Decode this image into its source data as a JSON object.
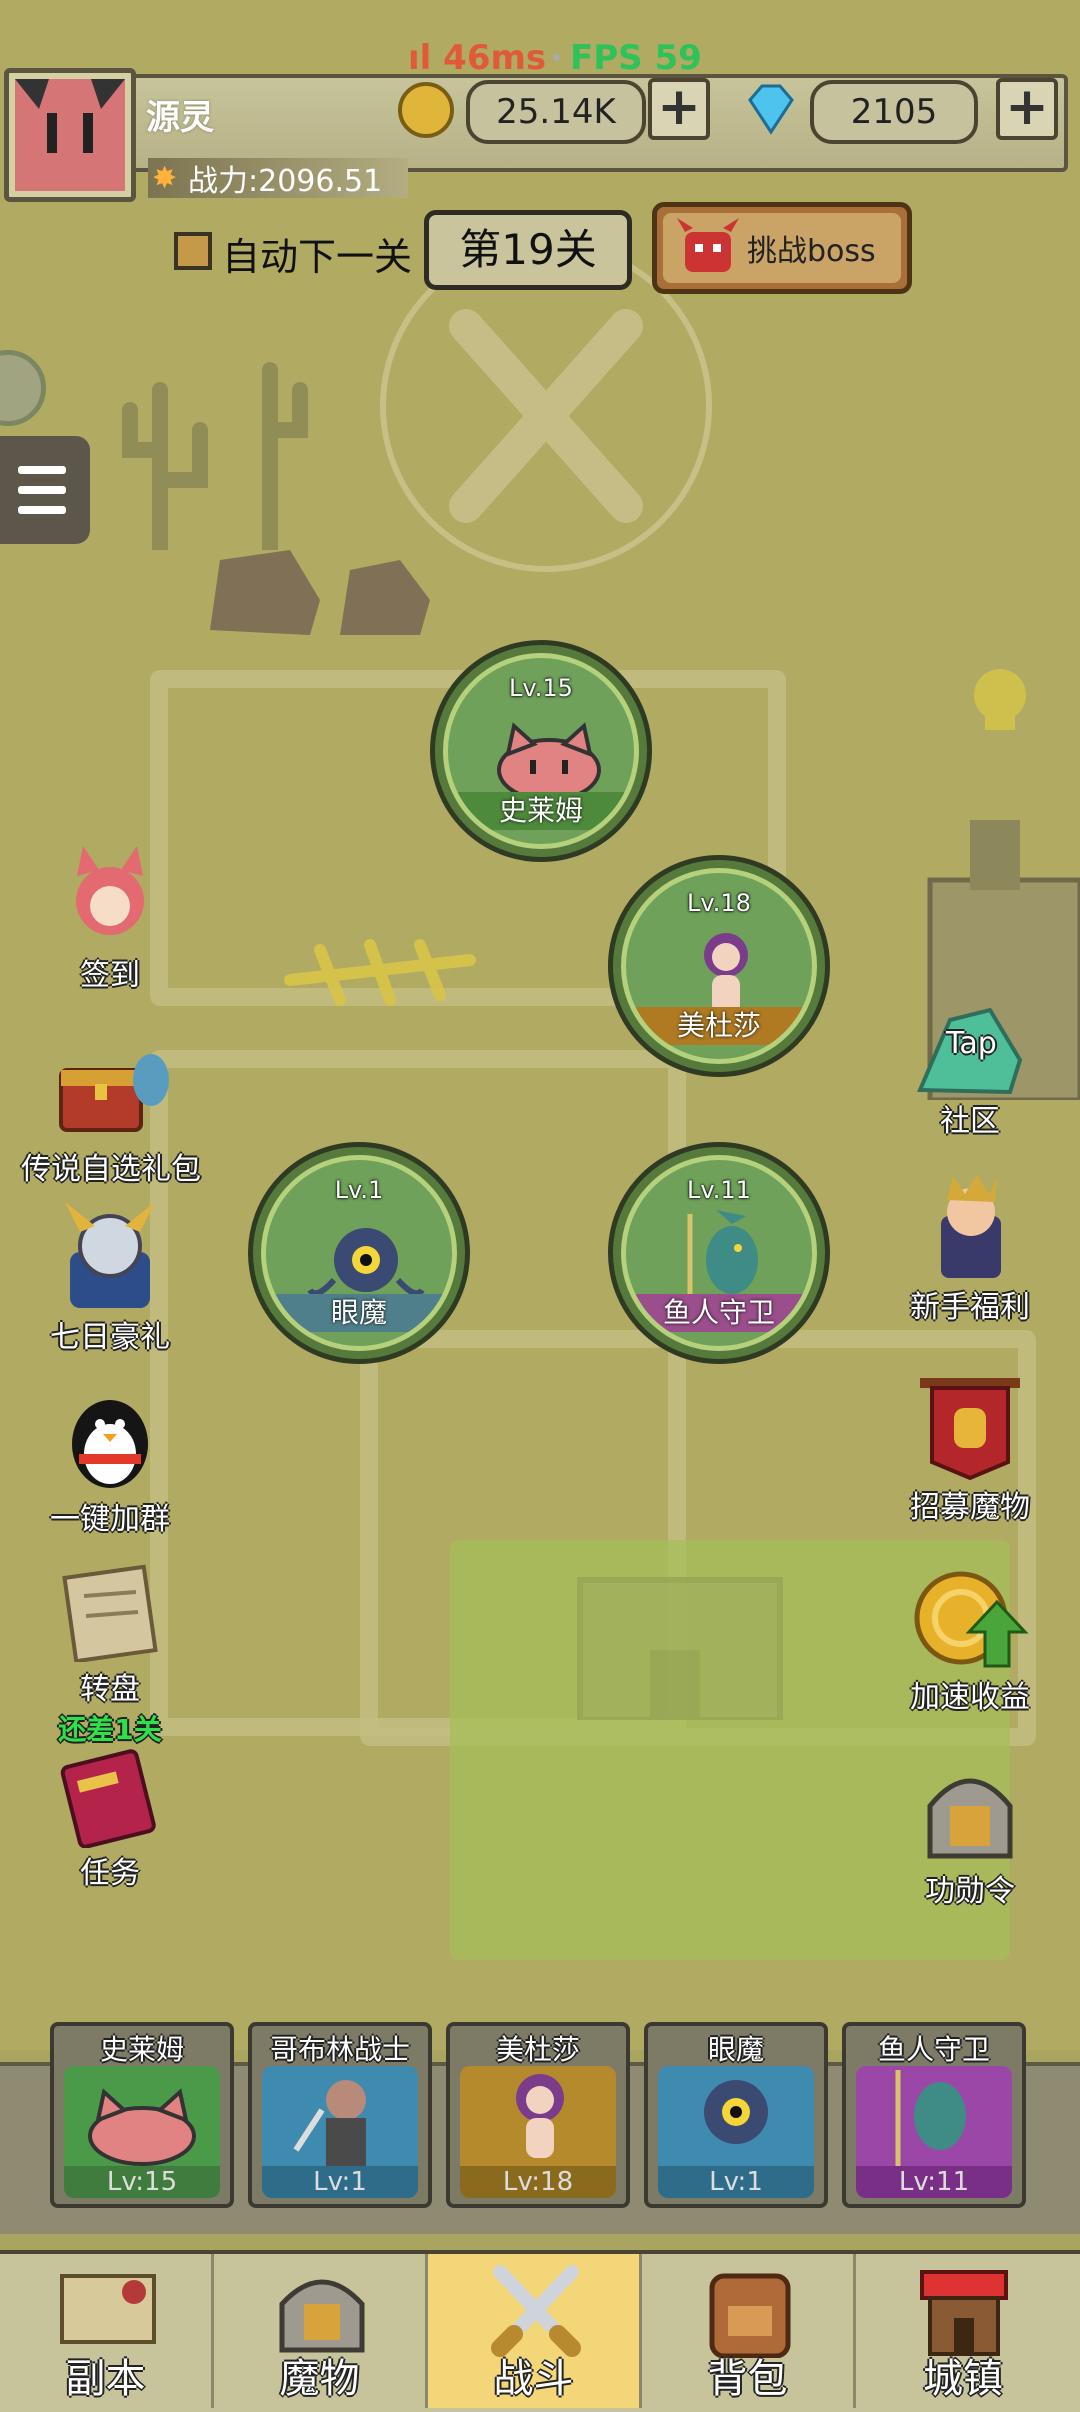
{
  "perf": {
    "ping": "46ms",
    "separator": "·",
    "fps": "FPS 59"
  },
  "player": {
    "name": "源灵",
    "power": "战力:2096.51"
  },
  "currency": {
    "gold": "25.14K",
    "gems": "2105"
  },
  "stage": {
    "auto_next_label": "自动下一关",
    "auto_next_checked": false,
    "current": "第19关",
    "boss_button": "挑战boss"
  },
  "map_nodes": [
    {
      "level": "Lv.15",
      "name": "史莱姆",
      "band_color": "#4d8a3b"
    },
    {
      "level": "Lv.18",
      "name": "美杜莎",
      "band_color": "#b07a22"
    },
    {
      "level": "Lv.1",
      "name": "眼魔",
      "band_color": "#4f7f8a"
    },
    {
      "level": "Lv.11",
      "name": "鱼人守卫",
      "band_color": "#9a4e8b"
    }
  ],
  "left_menu": [
    {
      "label": "签到",
      "icon": "catgirl-icon"
    },
    {
      "label": "传说自选礼包",
      "icon": "treasure-chest-icon"
    },
    {
      "label": "七日豪礼",
      "icon": "knight-icon"
    },
    {
      "label": "一键加群",
      "icon": "penguin-icon"
    },
    {
      "label": "转盘",
      "sub": "还差1关",
      "icon": "scroll-icon"
    },
    {
      "label": "任务",
      "icon": "book-icon"
    }
  ],
  "right_menu": [
    {
      "label": "社区",
      "icon": "tap-community-icon",
      "icon_text": "Tap"
    },
    {
      "label": "新手福利",
      "icon": "warrior-icon"
    },
    {
      "label": "招募魔物",
      "icon": "banner-helmet-icon"
    },
    {
      "label": "加速收益",
      "icon": "gold-coin-arrow-icon"
    },
    {
      "label": "功勋令",
      "icon": "helmet-icon"
    }
  ],
  "team": [
    {
      "name": "史莱姆",
      "level": "Lv:15",
      "bg": "#4b9a4a"
    },
    {
      "name": "哥布林战士",
      "level": "Lv:1",
      "bg": "#3f8bb0"
    },
    {
      "name": "美杜莎",
      "level": "Lv:18",
      "bg": "#b58a2c"
    },
    {
      "name": "眼魔",
      "level": "Lv:1",
      "bg": "#3f8bb0"
    },
    {
      "name": "鱼人守卫",
      "level": "Lv:11",
      "bg": "#9b47a8"
    }
  ],
  "nav": [
    {
      "label": "副本",
      "icon": "map-icon",
      "active": false
    },
    {
      "label": "魔物",
      "icon": "helmet-icon",
      "active": false
    },
    {
      "label": "战斗",
      "icon": "crossed-swords-icon",
      "active": true
    },
    {
      "label": "背包",
      "icon": "backpack-icon",
      "active": false
    },
    {
      "label": "城镇",
      "icon": "shop-icon",
      "active": false
    }
  ]
}
